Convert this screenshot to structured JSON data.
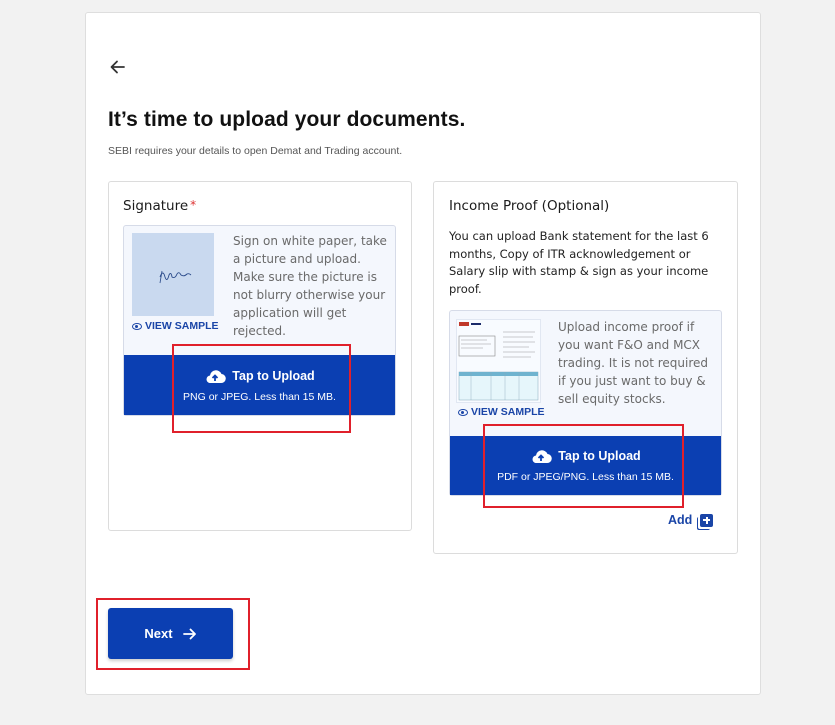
{
  "page": {
    "title": "It’s time to upload your documents.",
    "subtitle": "SEBI requires your details to open Demat and Trading account."
  },
  "signature": {
    "label": "Signature",
    "required_mark": "*",
    "view_sample": "VIEW SAMPLE",
    "hint": "Sign on white paper, take a picture and upload. Make sure the picture is not blurry otherwise your application will get rejected.",
    "upload_label": "Tap to Upload",
    "upload_formats": "PNG or JPEG. Less than 15 MB."
  },
  "income": {
    "label": "Income Proof (Optional)",
    "description": "You can upload Bank statement for the last 6 months, Copy of ITR acknowledgement or Salary slip with stamp & sign as your income proof.",
    "view_sample": "VIEW SAMPLE",
    "hint": "Upload income proof if you want F&O and MCX trading. It is not required if you just want to buy & sell equity stocks.",
    "upload_label": "Tap to Upload",
    "upload_formats": "PDF or JPEG/PNG. Less than 15 MB.",
    "add_label": "Add"
  },
  "actions": {
    "next_label": "Next"
  },
  "colors": {
    "primary": "#0b3fb2",
    "highlight": "#e0202b",
    "required": "#d33333"
  },
  "icons": [
    "back-arrow-icon",
    "eye-icon",
    "cloud-upload-icon",
    "add-icon",
    "arrow-right-icon"
  ]
}
